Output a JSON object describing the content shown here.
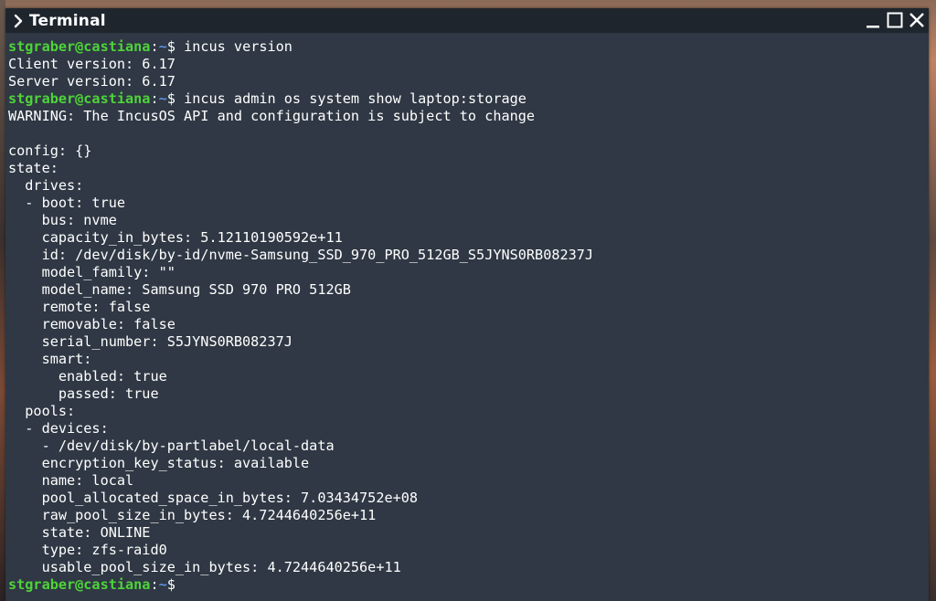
{
  "window": {
    "title": "Terminal",
    "icon": "chevron-right-icon",
    "controls": [
      "minimize-icon",
      "maximize-icon",
      "close-icon"
    ]
  },
  "colors": {
    "terminal_bg": "#2f3844",
    "titlebar_bg": "#1f252d",
    "prompt_user": "#4fd33a",
    "prompt_path": "#5c8fe0",
    "text": "#ffffff"
  },
  "prompt": {
    "user_host": "stgraber@castiana",
    "separator": ":",
    "path": "~",
    "symbol": "$ "
  },
  "terminal": {
    "cmd1": "incus version",
    "out_client": "Client version: 6.17",
    "out_server": "Server version: 6.17",
    "cmd2": "incus admin os system show laptop:storage",
    "out_warning": "WARNING: The IncusOS API and configuration is subject to change",
    "blank": "",
    "config": "config: {}",
    "state": "state:",
    "drives": "  drives:",
    "boot": "  - boot: true",
    "bus": "    bus: nvme",
    "capacity": "    capacity_in_bytes: 5.12110190592e+11",
    "id": "    id: /dev/disk/by-id/nvme-Samsung_SSD_970_PRO_512GB_S5JYNS0RB08237J",
    "model_family": "    model_family: \"\"",
    "model_name": "    model_name: Samsung SSD 970 PRO 512GB",
    "remote": "    remote: false",
    "removable": "    removable: false",
    "serial": "    serial_number: S5JYNS0RB08237J",
    "smart": "    smart:",
    "smart_enabled": "      enabled: true",
    "smart_passed": "      passed: true",
    "pools": "  pools:",
    "devices": "  - devices:",
    "device1": "    - /dev/disk/by-partlabel/local-data",
    "encryption": "    encryption_key_status: available",
    "name": "    name: local",
    "pool_alloc": "    pool_allocated_space_in_bytes: 7.03434752e+08",
    "raw_pool": "    raw_pool_size_in_bytes: 4.7244640256e+11",
    "pool_state": "    state: ONLINE",
    "type": "    type: zfs-raid0",
    "usable": "    usable_pool_size_in_bytes: 4.7244640256e+11"
  }
}
